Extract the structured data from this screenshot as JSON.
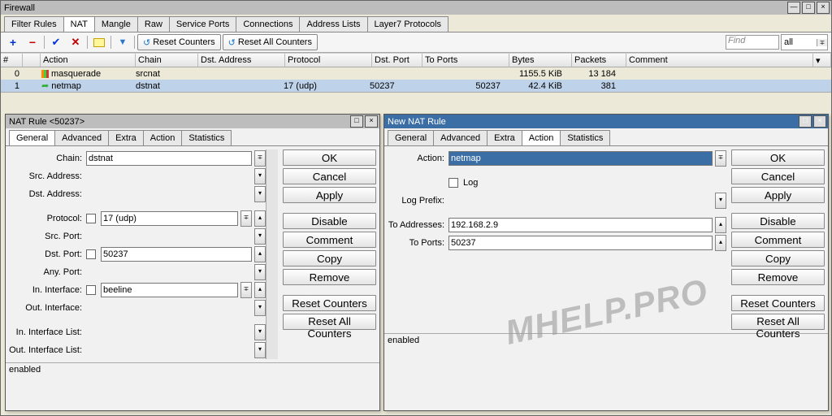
{
  "main": {
    "title": "Firewall",
    "tabs": [
      "Filter Rules",
      "NAT",
      "Mangle",
      "Raw",
      "Service Ports",
      "Connections",
      "Address Lists",
      "Layer7 Protocols"
    ],
    "active_tab": "NAT",
    "toolbar": {
      "reset_counters": "Reset Counters",
      "reset_all_counters": "Reset All Counters",
      "find_placeholder": "Find",
      "filter_all": "all"
    },
    "columns": [
      "#",
      "",
      "Action",
      "Chain",
      "Dst. Address",
      "Protocol",
      "Dst. Port",
      "To Ports",
      "Bytes",
      "Packets",
      "Comment"
    ],
    "rows": [
      {
        "idx": "0",
        "action": "masquerade",
        "chain": "srcnat",
        "dst": "",
        "proto": "",
        "dstp": "",
        "top": "",
        "bytes": "1155.5 KiB",
        "pkt": "13 184"
      },
      {
        "idx": "1",
        "action": "netmap",
        "chain": "dstnat",
        "dst": "",
        "proto": "17 (udp)",
        "dstp": "50237",
        "top": "50237",
        "bytes": "42.4 KiB",
        "pkt": "381"
      }
    ]
  },
  "left": {
    "title": "NAT Rule <50237>",
    "tabs": [
      "General",
      "Advanced",
      "Extra",
      "Action",
      "Statistics"
    ],
    "active_tab": "General",
    "fields": {
      "chain_label": "Chain:",
      "chain": "dstnat",
      "src_label": "Src. Address:",
      "src": "",
      "dst_label": "Dst. Address:",
      "dst": "",
      "proto_label": "Protocol:",
      "proto": "17 (udp)",
      "srcp_label": "Src. Port:",
      "srcp": "",
      "dstp_label": "Dst. Port:",
      "dstp": "50237",
      "anyp_label": "Any. Port:",
      "anyp": "",
      "inif_label": "In. Interface:",
      "inif": "beeline",
      "outif_label": "Out. Interface:",
      "outif": "",
      "iniflist_label": "In. Interface List:",
      "iniflist": "",
      "outiflist_label": "Out. Interface List:",
      "outiflist": ""
    },
    "buttons": [
      "OK",
      "Cancel",
      "Apply",
      "Disable",
      "Comment",
      "Copy",
      "Remove",
      "Reset Counters",
      "Reset All Counters"
    ],
    "status": "enabled"
  },
  "right": {
    "title": "New NAT Rule",
    "tabs": [
      "General",
      "Advanced",
      "Extra",
      "Action",
      "Statistics"
    ],
    "active_tab": "Action",
    "fields": {
      "action_label": "Action:",
      "action": "netmap",
      "log_label": "Log",
      "logp_label": "Log Prefix:",
      "logp": "",
      "toaddr_label": "To Addresses:",
      "toaddr": "192.168.2.9",
      "toport_label": "To Ports:",
      "toport": "50237"
    },
    "buttons": [
      "OK",
      "Cancel",
      "Apply",
      "Disable",
      "Comment",
      "Copy",
      "Remove",
      "Reset Counters",
      "Reset All Counters"
    ],
    "status": "enabled"
  },
  "watermark": "MHELP.PRO"
}
